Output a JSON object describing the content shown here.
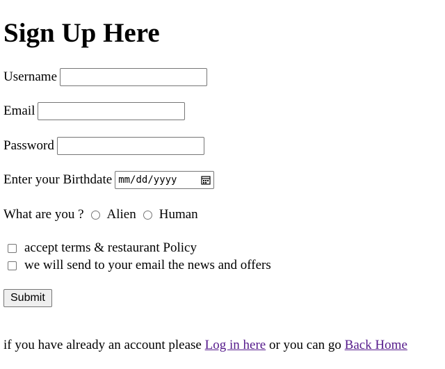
{
  "page": {
    "title": "Sign Up Here"
  },
  "form": {
    "username_label": "Username",
    "username_value": "",
    "email_label": "Email",
    "email_value": "",
    "password_label": "Password",
    "password_value": "",
    "birthdate_label": "Enter your Birthdate",
    "birthdate_placeholder": "mm/dd/yyyy",
    "species_label": "What are you ?",
    "species_options": [
      "Alien",
      "Human"
    ],
    "terms_label": "accept terms & restaurant Policy",
    "news_label": "we will send to your email the news and offers",
    "submit_label": "Submit"
  },
  "footer": {
    "text_before": "if you have already an account please",
    "login_link": "Log in here",
    "text_middle": "or you can go",
    "home_link": "Back Home"
  },
  "icons": {
    "calendar": "calendar-icon",
    "link_color": "#551a8b"
  }
}
